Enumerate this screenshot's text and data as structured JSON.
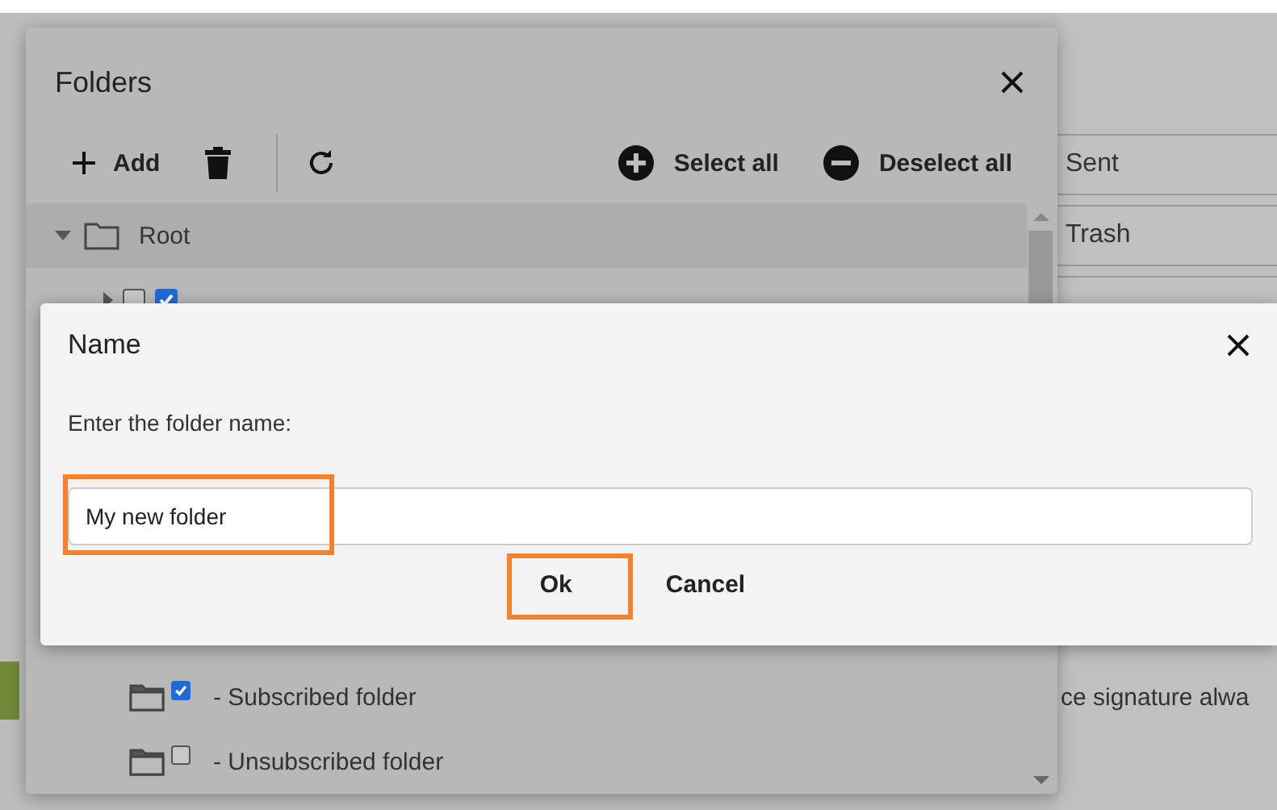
{
  "background": {
    "folders": [
      "Sent",
      "Trash"
    ],
    "signature_text": "ce signature alwa"
  },
  "folders_dialog": {
    "title": "Folders",
    "toolbar": [
      {
        "kind": "add",
        "label": "Add"
      },
      {
        "kind": "delete"
      },
      {
        "kind": "refresh"
      },
      {
        "kind": "select_all",
        "label": "Select all"
      },
      {
        "kind": "deselect_all",
        "label": "Deselect all"
      }
    ],
    "tree": [
      {
        "label": "Root",
        "expanded": true,
        "children": [
          {
            "expanded": false,
            "checked": false,
            "subscribed": true
          }
        ]
      }
    ],
    "legend": [
      {
        "label": "- Subscribed folder",
        "checked": true
      },
      {
        "label": "- Unsubscribed folder",
        "checked": false
      }
    ]
  },
  "name_dialog": {
    "title": "Name",
    "prompt": "Enter the folder name:",
    "value": "My new folder",
    "value_highlighted": true,
    "buttons": [
      {
        "label": "Ok",
        "highlighted": true
      },
      {
        "label": "Cancel",
        "highlighted": false
      }
    ]
  }
}
